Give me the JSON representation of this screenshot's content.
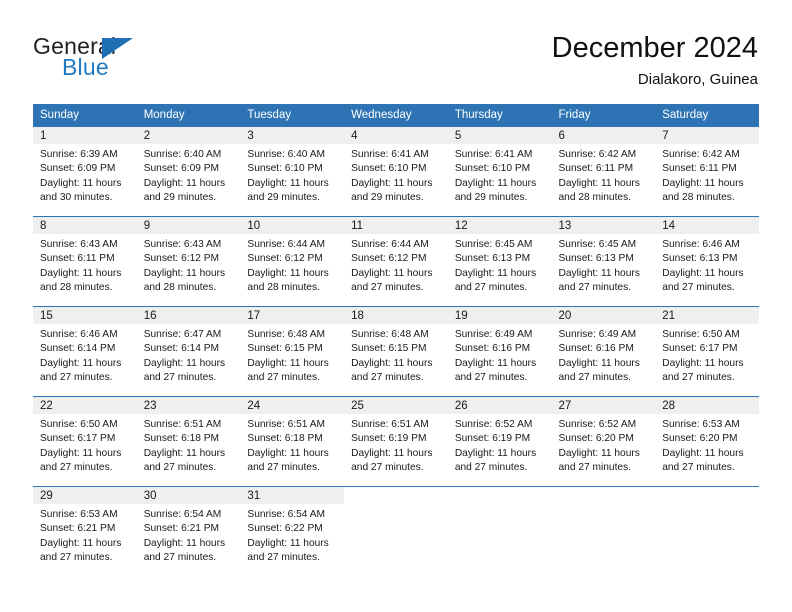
{
  "logo": {
    "text_top": "General",
    "text_bottom": "Blue",
    "triangle_color": "#1f6fb5",
    "blue_text_color": "#1f7ac4"
  },
  "header": {
    "title": "December 2024",
    "subtitle": "Dialakoro, Guinea"
  },
  "colors": {
    "header_blue": "#2e74b5",
    "daynum_band": "#efefef",
    "text": "#1a1a1a"
  },
  "calendar": {
    "weekdays": [
      "Sunday",
      "Monday",
      "Tuesday",
      "Wednesday",
      "Thursday",
      "Friday",
      "Saturday"
    ],
    "weeks": [
      [
        {
          "day": "1",
          "sunrise": "Sunrise: 6:39 AM",
          "sunset": "Sunset: 6:09 PM",
          "daylight1": "Daylight: 11 hours",
          "daylight2": "and 30 minutes."
        },
        {
          "day": "2",
          "sunrise": "Sunrise: 6:40 AM",
          "sunset": "Sunset: 6:09 PM",
          "daylight1": "Daylight: 11 hours",
          "daylight2": "and 29 minutes."
        },
        {
          "day": "3",
          "sunrise": "Sunrise: 6:40 AM",
          "sunset": "Sunset: 6:10 PM",
          "daylight1": "Daylight: 11 hours",
          "daylight2": "and 29 minutes."
        },
        {
          "day": "4",
          "sunrise": "Sunrise: 6:41 AM",
          "sunset": "Sunset: 6:10 PM",
          "daylight1": "Daylight: 11 hours",
          "daylight2": "and 29 minutes."
        },
        {
          "day": "5",
          "sunrise": "Sunrise: 6:41 AM",
          "sunset": "Sunset: 6:10 PM",
          "daylight1": "Daylight: 11 hours",
          "daylight2": "and 29 minutes."
        },
        {
          "day": "6",
          "sunrise": "Sunrise: 6:42 AM",
          "sunset": "Sunset: 6:11 PM",
          "daylight1": "Daylight: 11 hours",
          "daylight2": "and 28 minutes."
        },
        {
          "day": "7",
          "sunrise": "Sunrise: 6:42 AM",
          "sunset": "Sunset: 6:11 PM",
          "daylight1": "Daylight: 11 hours",
          "daylight2": "and 28 minutes."
        }
      ],
      [
        {
          "day": "8",
          "sunrise": "Sunrise: 6:43 AM",
          "sunset": "Sunset: 6:11 PM",
          "daylight1": "Daylight: 11 hours",
          "daylight2": "and 28 minutes."
        },
        {
          "day": "9",
          "sunrise": "Sunrise: 6:43 AM",
          "sunset": "Sunset: 6:12 PM",
          "daylight1": "Daylight: 11 hours",
          "daylight2": "and 28 minutes."
        },
        {
          "day": "10",
          "sunrise": "Sunrise: 6:44 AM",
          "sunset": "Sunset: 6:12 PM",
          "daylight1": "Daylight: 11 hours",
          "daylight2": "and 28 minutes."
        },
        {
          "day": "11",
          "sunrise": "Sunrise: 6:44 AM",
          "sunset": "Sunset: 6:12 PM",
          "daylight1": "Daylight: 11 hours",
          "daylight2": "and 27 minutes."
        },
        {
          "day": "12",
          "sunrise": "Sunrise: 6:45 AM",
          "sunset": "Sunset: 6:13 PM",
          "daylight1": "Daylight: 11 hours",
          "daylight2": "and 27 minutes."
        },
        {
          "day": "13",
          "sunrise": "Sunrise: 6:45 AM",
          "sunset": "Sunset: 6:13 PM",
          "daylight1": "Daylight: 11 hours",
          "daylight2": "and 27 minutes."
        },
        {
          "day": "14",
          "sunrise": "Sunrise: 6:46 AM",
          "sunset": "Sunset: 6:13 PM",
          "daylight1": "Daylight: 11 hours",
          "daylight2": "and 27 minutes."
        }
      ],
      [
        {
          "day": "15",
          "sunrise": "Sunrise: 6:46 AM",
          "sunset": "Sunset: 6:14 PM",
          "daylight1": "Daylight: 11 hours",
          "daylight2": "and 27 minutes."
        },
        {
          "day": "16",
          "sunrise": "Sunrise: 6:47 AM",
          "sunset": "Sunset: 6:14 PM",
          "daylight1": "Daylight: 11 hours",
          "daylight2": "and 27 minutes."
        },
        {
          "day": "17",
          "sunrise": "Sunrise: 6:48 AM",
          "sunset": "Sunset: 6:15 PM",
          "daylight1": "Daylight: 11 hours",
          "daylight2": "and 27 minutes."
        },
        {
          "day": "18",
          "sunrise": "Sunrise: 6:48 AM",
          "sunset": "Sunset: 6:15 PM",
          "daylight1": "Daylight: 11 hours",
          "daylight2": "and 27 minutes."
        },
        {
          "day": "19",
          "sunrise": "Sunrise: 6:49 AM",
          "sunset": "Sunset: 6:16 PM",
          "daylight1": "Daylight: 11 hours",
          "daylight2": "and 27 minutes."
        },
        {
          "day": "20",
          "sunrise": "Sunrise: 6:49 AM",
          "sunset": "Sunset: 6:16 PM",
          "daylight1": "Daylight: 11 hours",
          "daylight2": "and 27 minutes."
        },
        {
          "day": "21",
          "sunrise": "Sunrise: 6:50 AM",
          "sunset": "Sunset: 6:17 PM",
          "daylight1": "Daylight: 11 hours",
          "daylight2": "and 27 minutes."
        }
      ],
      [
        {
          "day": "22",
          "sunrise": "Sunrise: 6:50 AM",
          "sunset": "Sunset: 6:17 PM",
          "daylight1": "Daylight: 11 hours",
          "daylight2": "and 27 minutes."
        },
        {
          "day": "23",
          "sunrise": "Sunrise: 6:51 AM",
          "sunset": "Sunset: 6:18 PM",
          "daylight1": "Daylight: 11 hours",
          "daylight2": "and 27 minutes."
        },
        {
          "day": "24",
          "sunrise": "Sunrise: 6:51 AM",
          "sunset": "Sunset: 6:18 PM",
          "daylight1": "Daylight: 11 hours",
          "daylight2": "and 27 minutes."
        },
        {
          "day": "25",
          "sunrise": "Sunrise: 6:51 AM",
          "sunset": "Sunset: 6:19 PM",
          "daylight1": "Daylight: 11 hours",
          "daylight2": "and 27 minutes."
        },
        {
          "day": "26",
          "sunrise": "Sunrise: 6:52 AM",
          "sunset": "Sunset: 6:19 PM",
          "daylight1": "Daylight: 11 hours",
          "daylight2": "and 27 minutes."
        },
        {
          "day": "27",
          "sunrise": "Sunrise: 6:52 AM",
          "sunset": "Sunset: 6:20 PM",
          "daylight1": "Daylight: 11 hours",
          "daylight2": "and 27 minutes."
        },
        {
          "day": "28",
          "sunrise": "Sunrise: 6:53 AM",
          "sunset": "Sunset: 6:20 PM",
          "daylight1": "Daylight: 11 hours",
          "daylight2": "and 27 minutes."
        }
      ],
      [
        {
          "day": "29",
          "sunrise": "Sunrise: 6:53 AM",
          "sunset": "Sunset: 6:21 PM",
          "daylight1": "Daylight: 11 hours",
          "daylight2": "and 27 minutes."
        },
        {
          "day": "30",
          "sunrise": "Sunrise: 6:54 AM",
          "sunset": "Sunset: 6:21 PM",
          "daylight1": "Daylight: 11 hours",
          "daylight2": "and 27 minutes."
        },
        {
          "day": "31",
          "sunrise": "Sunrise: 6:54 AM",
          "sunset": "Sunset: 6:22 PM",
          "daylight1": "Daylight: 11 hours",
          "daylight2": "and 27 minutes."
        },
        {
          "day": "",
          "sunrise": "",
          "sunset": "",
          "daylight1": "",
          "daylight2": ""
        },
        {
          "day": "",
          "sunrise": "",
          "sunset": "",
          "daylight1": "",
          "daylight2": ""
        },
        {
          "day": "",
          "sunrise": "",
          "sunset": "",
          "daylight1": "",
          "daylight2": ""
        },
        {
          "day": "",
          "sunrise": "",
          "sunset": "",
          "daylight1": "",
          "daylight2": ""
        }
      ]
    ]
  }
}
